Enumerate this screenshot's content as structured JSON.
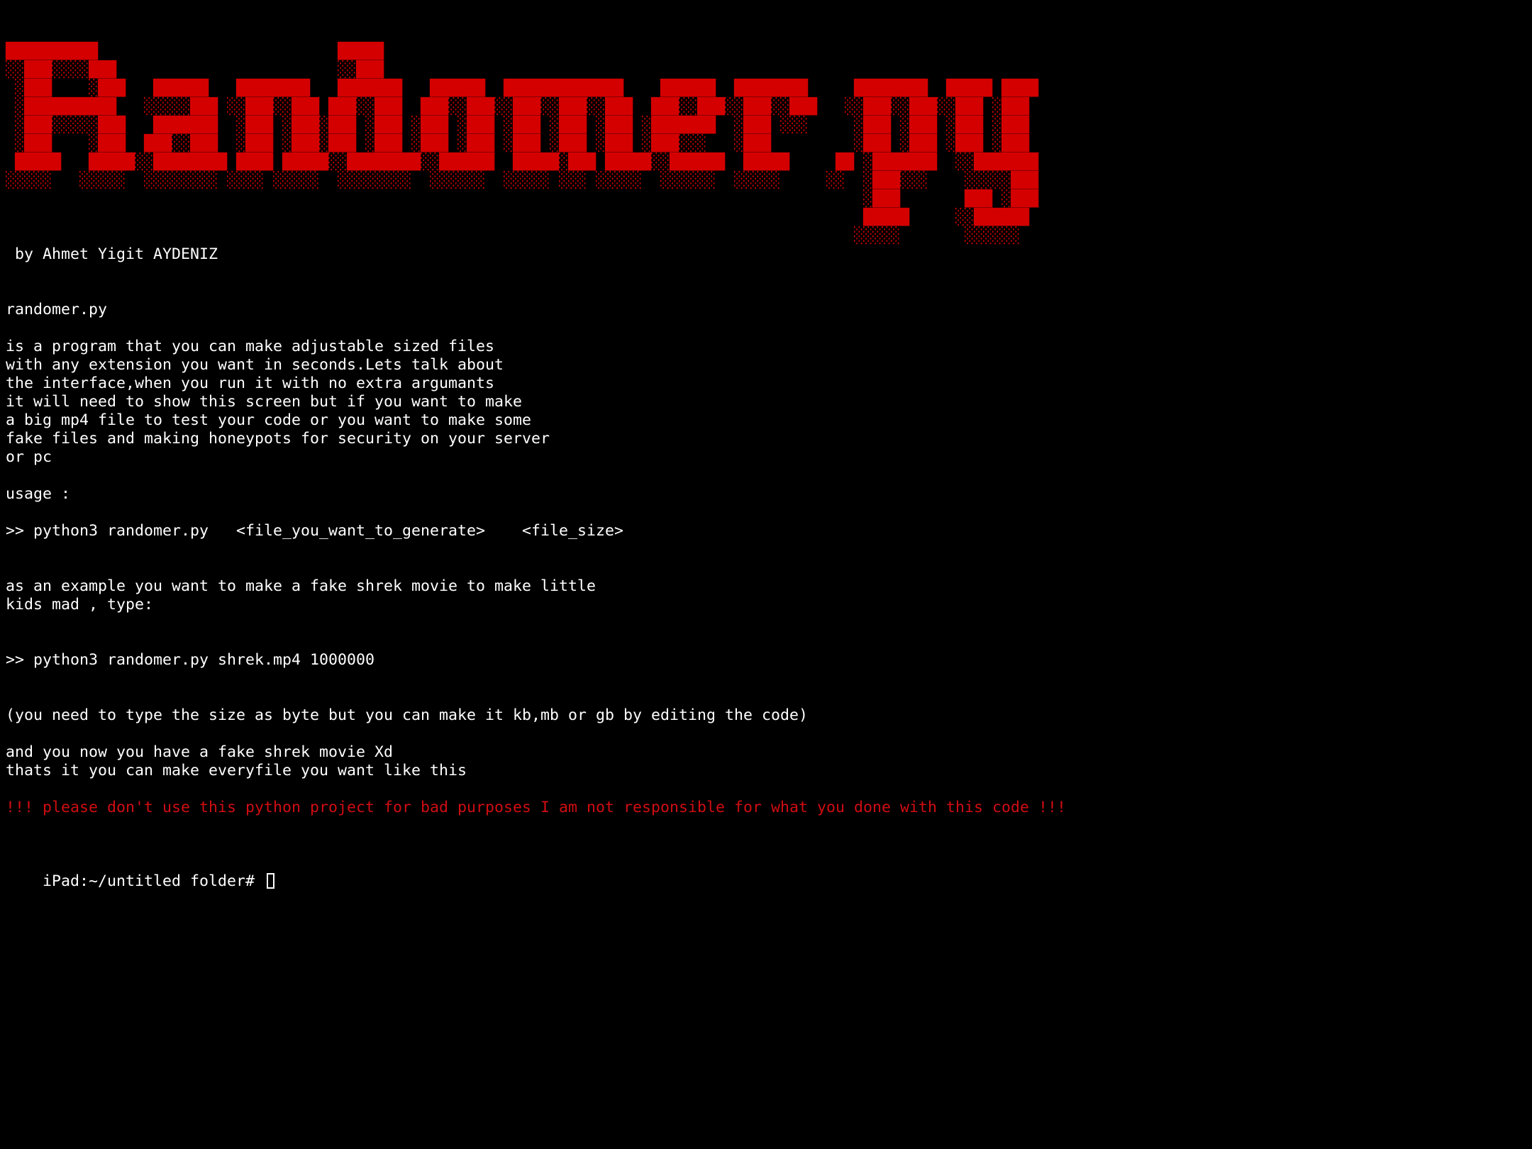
{
  "banner": {
    "lines": [
      "██████████                          █████",
      "░░███░░░░███                        ░░███",
      " ░███    ░███   ██████   ████████   ███████   ██████  █████████████    ██████  ████████     ████████  █████ ████",
      " ░██████████   ░░░░░███ ░░███░░███ ███░░███  ███░░███░░███░░███░░███  ███░░███░░███░░███   ░░███░░███░░███ ░███",
      " ░███░░░░░███   ███████  ░███ ░███░███ ░███ ░███ ░███ ░███ ░███ ░███ ░███████  ░███ ░░░     ░███ ░███ ░███ ░███",
      " ░███    ░███  ███░░███  ░███ ░███░███ ░███ ░███ ░███ ░███ ░███ ░███ ░███░░░   ░███         ░███ ░███ ░███ ░███",
      " █████   █████░░████████ ████ █████░░████████░░██████  █████░███ █████░░██████  █████     ██ ░███████  ░░███████",
      "░░░░░   ░░░░░  ░░░░░░░░ ░░░░ ░░░░░  ░░░░░░░░  ░░░░░░  ░░░░░ ░░░ ░░░░░  ░░░░░░  ░░░░░     ░░  ░███░░░    ░░░░░███",
      "                                                                                             ░███       ███ ░███",
      "                                                                                             █████     ░░██████",
      "                                                                                            ░░░░░       ░░░░░░"
    ]
  },
  "author": " by Ahmet Yigit AYDENIZ",
  "program_name": "randomer.py",
  "description": [
    "is a program that you can make adjustable sized files",
    "with any extension you want in seconds.Lets talk about",
    "the interface,when you run it with no extra argumants",
    "it will need to show this screen but if you want to make",
    "a big mp4 file to test your code or you want to make some",
    "fake files and making honeypots for security on your server",
    "or pc"
  ],
  "usage_label": "usage :",
  "usage_command": ">> python3 randomer.py   <file_you_want_to_generate>    <file_size>",
  "example_intro": [
    "as an example you want to make a fake shrek movie to make little",
    "kids mad , type:"
  ],
  "example_command": ">> python3 randomer.py shrek.mp4 1000000",
  "size_note": "(you need to type the size as byte but you can make it kb,mb or gb by editing the code)",
  "outro": [
    "and you now you have a fake shrek movie Xd",
    "thats it you can make everyfile you want like this"
  ],
  "warning": "!!! please don't use this python project for bad purposes I am not responsible for what you done with this code !!!",
  "prompt": "iPad:~/untitled folder# ",
  "colors": {
    "background": "#000000",
    "text": "#ffffff",
    "banner": "#d40000",
    "warning": "#d10d12"
  }
}
